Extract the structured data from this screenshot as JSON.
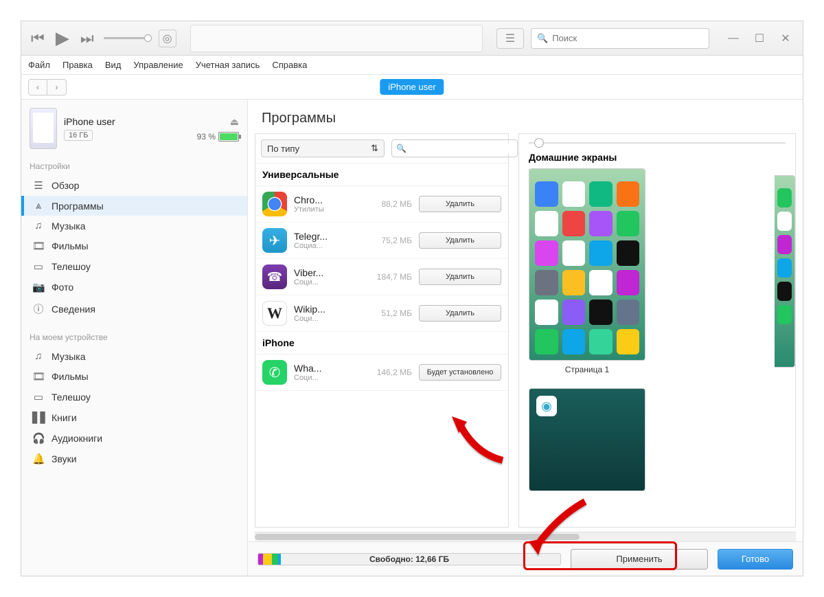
{
  "menubar": {
    "items": [
      "Файл",
      "Правка",
      "Вид",
      "Управление",
      "Учетная запись",
      "Справка"
    ]
  },
  "search": {
    "placeholder": "Поиск"
  },
  "device_pill": "iPhone user",
  "device": {
    "name": "iPhone user",
    "capacity": "16 ГБ",
    "battery_pct": "93 %"
  },
  "sidebar": {
    "section1_title": "Настройки",
    "section1": [
      {
        "icon": "☰",
        "label": "Обзор"
      },
      {
        "icon": "⩓",
        "label": "Программы"
      },
      {
        "icon": "♫",
        "label": "Музыка"
      },
      {
        "icon": "🎞",
        "label": "Фильмы"
      },
      {
        "icon": "▭",
        "label": "Телешоу"
      },
      {
        "icon": "📷",
        "label": "Фото"
      },
      {
        "icon": "ⓘ",
        "label": "Сведения"
      }
    ],
    "section2_title": "На моем устройстве",
    "section2": [
      {
        "icon": "♫",
        "label": "Музыка"
      },
      {
        "icon": "🎞",
        "label": "Фильмы"
      },
      {
        "icon": "▭",
        "label": "Телешоу"
      },
      {
        "icon": "▋▋",
        "label": "Книги"
      },
      {
        "icon": "🎧",
        "label": "Аудиокниги"
      },
      {
        "icon": "🔔",
        "label": "Звуки"
      }
    ]
  },
  "apps": {
    "title": "Программы",
    "sort_label": "По типу",
    "group1": "Универсальные",
    "group2": "iPhone",
    "delete_label": "Удалить",
    "install_label": "Будет установлено",
    "list1": [
      {
        "name": "Chro...",
        "cat": "Утилиты",
        "size": "88,2 МБ",
        "kind": "chrome"
      },
      {
        "name": "Telegr...",
        "cat": "Социа...",
        "size": "75,2 МБ",
        "kind": "telegram"
      },
      {
        "name": "Viber...",
        "cat": "Соци...",
        "size": "184,7 МБ",
        "kind": "viber"
      },
      {
        "name": "Wikip...",
        "cat": "Соци...",
        "size": "51,2 МБ",
        "kind": "wiki"
      }
    ],
    "list2": [
      {
        "name": "Wha...",
        "cat": "Соци...",
        "size": "146,2 МБ",
        "kind": "whatsapp"
      }
    ]
  },
  "screens": {
    "title": "Домашние экраны",
    "page1": "Страница 1"
  },
  "footer": {
    "free_label": "Свободно: 12,66 ГБ",
    "apply": "Применить",
    "done": "Готово"
  },
  "homescreen_colors": [
    "#3b82f6",
    "#fff",
    "#10b981",
    "#f97316",
    "#fff",
    "#ef4444",
    "#a855f7",
    "#22c55e",
    "#d946ef",
    "#fff",
    "#0ea5e9",
    "#111",
    "#6b7280",
    "#fbbf24",
    "#fff",
    "#c026d3",
    "#fff",
    "#8b5cf6",
    "#111",
    "#64748b",
    "#22c55e",
    "#0ea5e9",
    "#34d399",
    "#facc15"
  ]
}
